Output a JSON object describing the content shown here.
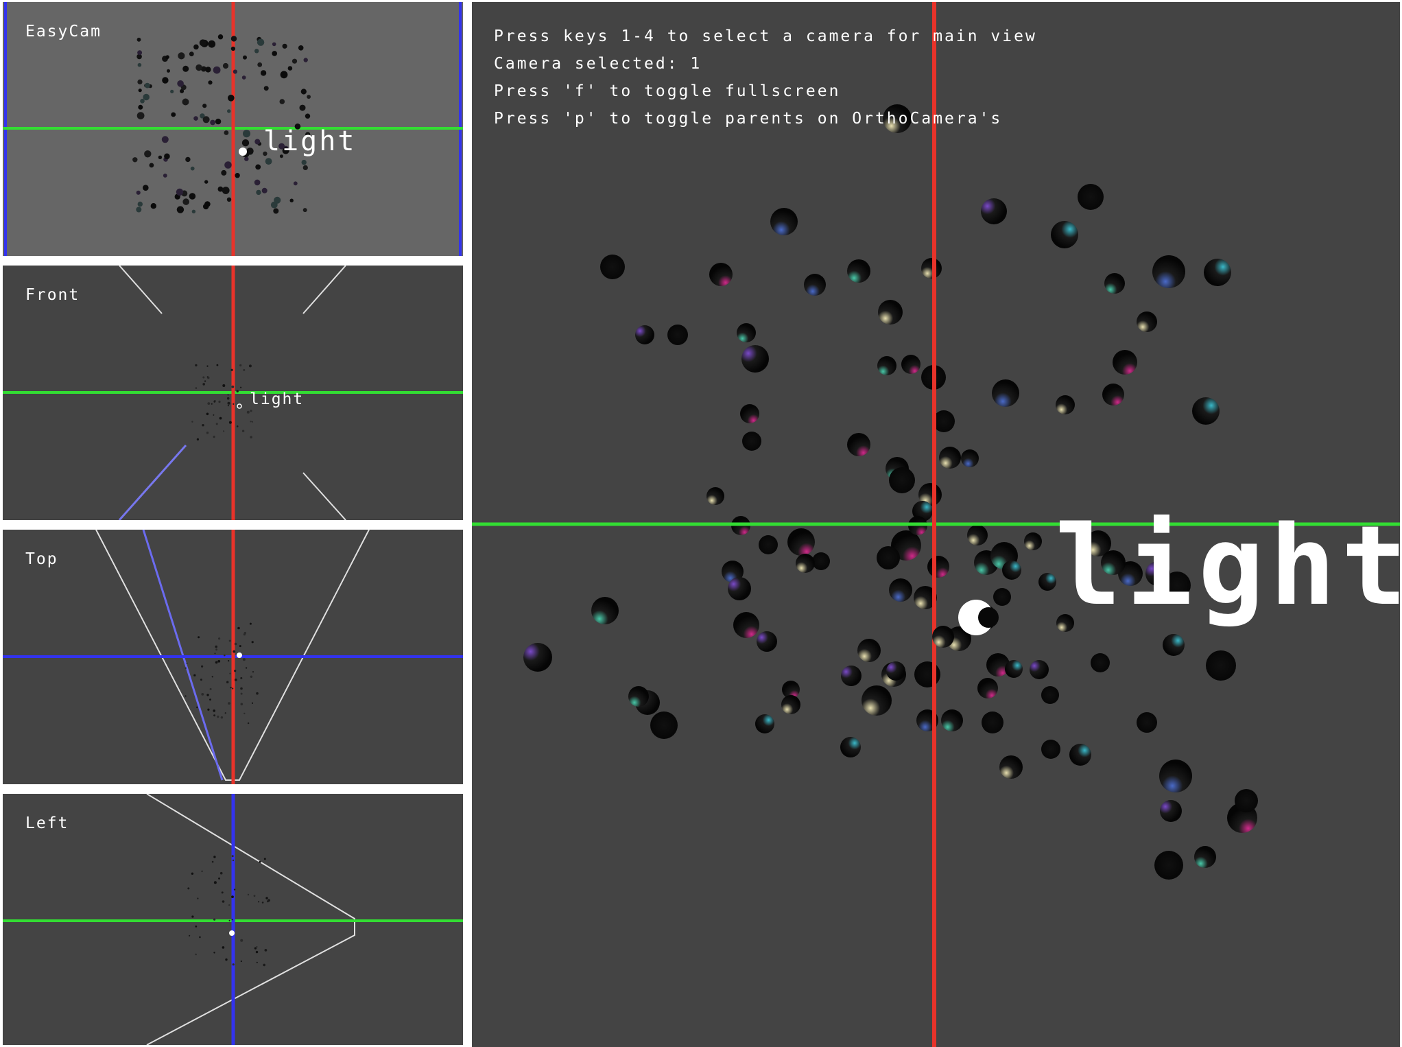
{
  "panels": {
    "easycam": {
      "label": "EasyCam"
    },
    "front": {
      "label": "Front"
    },
    "top": {
      "label": "Top"
    },
    "left": {
      "label": "Left"
    }
  },
  "main_view": {
    "instructions": [
      "Press keys 1-4 to select a camera for main view",
      "Camera selected: 1",
      "Press 'f' to toggle fullscreen",
      "Press 'p' to toggle parents on OrthoCamera's"
    ],
    "light_label": "light",
    "camera_selected": 1
  },
  "light_labels": {
    "easycam": "light",
    "front": "light"
  },
  "colors": {
    "axis_x": "#33dd33",
    "axis_y": "#e8332a",
    "axis_z": "#3333ee",
    "frustum": "#e0e0e0",
    "background": "#444444",
    "easycam_background": "#666666"
  }
}
